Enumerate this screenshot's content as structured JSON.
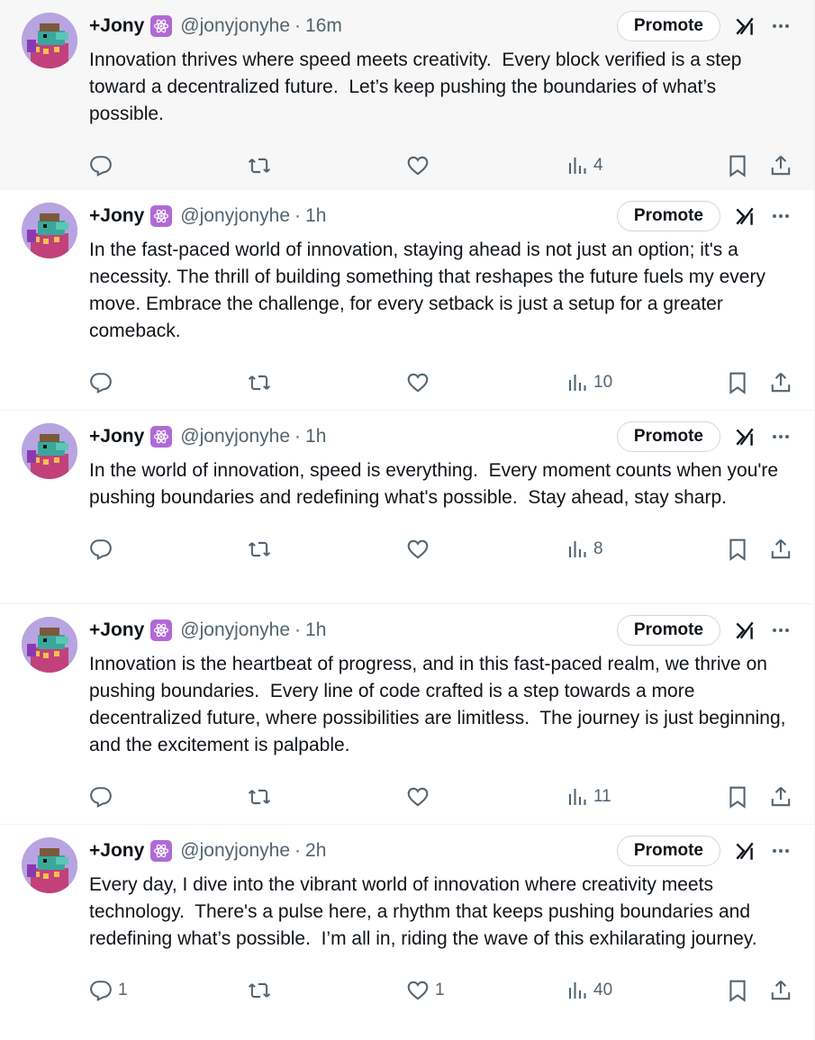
{
  "colors": {
    "text_primary": "#0f1419",
    "text_secondary": "#536471",
    "border": "#eff3f4",
    "badge": "#b06ad6",
    "hover_bg": "#f7f7f7"
  },
  "icons": [
    "avatar-image",
    "react-atom-icon",
    "grok-icon",
    "more-icon",
    "reply-icon",
    "retweet-icon",
    "like-icon",
    "views-icon",
    "bookmark-icon",
    "share-icon"
  ],
  "tweets": [
    {
      "name": "+Jony",
      "handle": "@jonyjonyhe",
      "dot": "·",
      "time": "16m",
      "promote": "Promote",
      "text": "Innovation thrives where speed meets creativity.  Every block verified is a step toward a decentralized future.  Let’s keep pushing the boundaries of what’s possible.",
      "replies": "",
      "retweets": "",
      "likes": "",
      "views": "4"
    },
    {
      "name": "+Jony",
      "handle": "@jonyjonyhe",
      "dot": "·",
      "time": "1h",
      "promote": "Promote",
      "text": "In the fast-paced world of innovation, staying ahead is not just an option; it's a necessity. The thrill of building something that reshapes the future fuels my every move. Embrace the challenge, for every setback is just a setup for a greater comeback.",
      "replies": "",
      "retweets": "",
      "likes": "",
      "views": "10"
    },
    {
      "name": "+Jony",
      "handle": "@jonyjonyhe",
      "dot": "·",
      "time": "1h",
      "promote": "Promote",
      "text": "In the world of innovation, speed is everything.  Every moment counts when you're pushing boundaries and redefining what's possible.  Stay ahead, stay sharp.",
      "replies": "",
      "retweets": "",
      "likes": "",
      "views": "8"
    },
    {
      "name": "+Jony",
      "handle": "@jonyjonyhe",
      "dot": "·",
      "time": "1h",
      "promote": "Promote",
      "text": "Innovation is the heartbeat of progress, and in this fast-paced realm, we thrive on pushing boundaries.  Every line of code crafted is a step towards a more decentralized future, where possibilities are limitless.  The journey is just beginning, and the excitement is palpable.",
      "replies": "",
      "retweets": "",
      "likes": "",
      "views": "11"
    },
    {
      "name": "+Jony",
      "handle": "@jonyjonyhe",
      "dot": "·",
      "time": "2h",
      "promote": "Promote",
      "text": "Every day, I dive into the vibrant world of innovation where creativity meets technology.  There's a pulse here, a rhythm that keeps pushing boundaries and redefining what’s possible.  I’m all in, riding the wave of this exhilarating journey.",
      "replies": "1",
      "retweets": "",
      "likes": "1",
      "views": "40"
    }
  ]
}
